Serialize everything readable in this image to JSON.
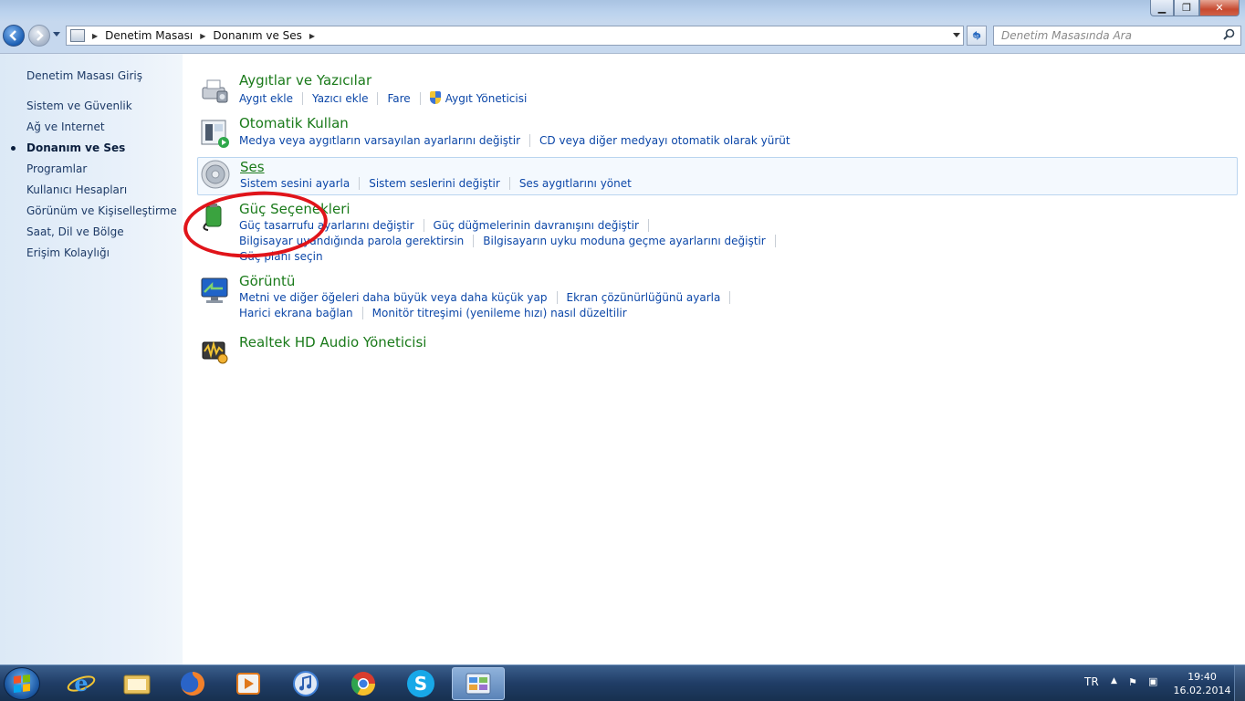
{
  "window": {
    "min_glyph": "▁",
    "max_glyph": "❐",
    "close_glyph": "✕"
  },
  "address": {
    "breadcrumbs": [
      "Denetim Masası",
      "Donanım ve Ses"
    ],
    "search_placeholder": "Denetim Masasında Ara"
  },
  "sidebar": {
    "items": [
      {
        "label": "Denetim Masası Giriş"
      },
      {
        "label": "Sistem ve Güvenlik"
      },
      {
        "label": "Ağ ve Internet"
      },
      {
        "label": "Donanım ve Ses"
      },
      {
        "label": "Programlar"
      },
      {
        "label": "Kullanıcı Hesapları"
      },
      {
        "label": "Görünüm ve Kişiselleştirme"
      },
      {
        "label": "Saat, Dil ve Bölge"
      },
      {
        "label": "Erişim Kolaylığı"
      }
    ]
  },
  "groups": [
    {
      "title": "Aygıtlar ve Yazıcılar",
      "icon": "printer-icon",
      "links": [
        "Aygıt ekle",
        "Yazıcı ekle",
        "Fare",
        "Aygıt Yöneticisi"
      ]
    },
    {
      "title": "Otomatik Kullan",
      "icon": "autoplay-icon",
      "links": [
        "Medya veya aygıtların varsayılan ayarlarını değiştir",
        "CD veya diğer medyayı otomatik olarak yürüt"
      ]
    },
    {
      "title": "Ses",
      "icon": "speaker-icon",
      "links": [
        "Sistem sesini ayarla",
        "Sistem seslerini değiştir",
        "Ses aygıtlarını yönet"
      ]
    },
    {
      "title": "Güç Seçenekleri",
      "icon": "battery-icon",
      "links": [
        "Güç tasarrufu ayarlarını değiştir",
        "Güç düğmelerinin davranışını değiştir",
        "Bilgisayar uyandığında parola gerektirsin",
        "Bilgisayarın uyku moduna geçme ayarlarını değiştir",
        "Güç planı seçin"
      ]
    },
    {
      "title": "Görüntü",
      "icon": "monitor-icon",
      "links": [
        "Metni ve diğer öğeleri daha büyük veya daha küçük yap",
        "Ekran çözünürlüğünü ayarla",
        "Harici ekrana bağlan",
        "Monitör titreşimi (yenileme hızı) nasıl düzeltilir"
      ]
    },
    {
      "title": "Realtek HD Audio Yöneticisi",
      "icon": "realtek-audio-icon",
      "links": []
    }
  ],
  "taskbar": {
    "skype_glyph": "S",
    "tray_lang": "TR",
    "tray_up_glyph": "▲",
    "tray_flag_glyph": "⚑",
    "tray_net_glyph": "▣",
    "time": "19:40",
    "date": "16.02.2014"
  }
}
